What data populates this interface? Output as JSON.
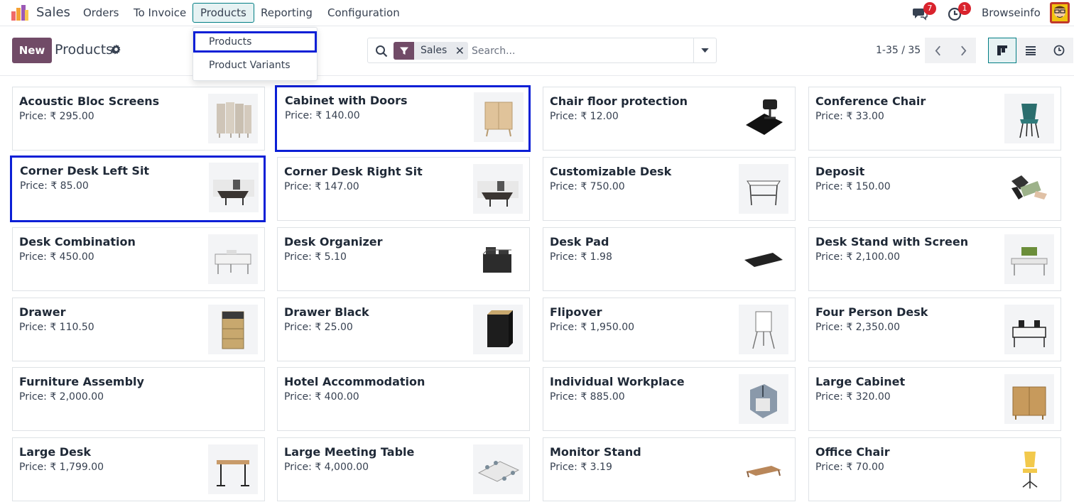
{
  "navbar": {
    "app_name": "Sales",
    "menu": [
      "Orders",
      "To Invoice",
      "Products",
      "Reporting",
      "Configuration"
    ],
    "active_menu": "Products",
    "messages_count": "7",
    "activities_count": "1",
    "company": "Browseinfo"
  },
  "products_dropdown": {
    "items": [
      "Products",
      "Product Variants"
    ]
  },
  "control_panel": {
    "new_label": "New",
    "title": "Products",
    "facet_label": "Sales",
    "search_placeholder": "Search...",
    "pager_value": "1-35 / 35"
  },
  "colors": {
    "brand": "#714b67",
    "active_accent": "#017e84",
    "highlight_box": "#0b1fd6",
    "badge": "#d9232d"
  },
  "products": [
    {
      "name": "Acoustic Bloc Screens",
      "price": "Price: ₹ 295.00",
      "image": "acoustic-screen"
    },
    {
      "name": "Cabinet with Doors",
      "price": "Price: ₹ 140.00",
      "image": "cabinet"
    },
    {
      "name": "Chair floor protection",
      "price": "Price: ₹ 12.00",
      "image": "floor-mat"
    },
    {
      "name": "Conference Chair",
      "price": "Price: ₹ 33.00",
      "image": "chair-teal"
    },
    {
      "name": "Corner Desk Left Sit",
      "price": "Price: ₹ 85.00",
      "image": "corner-desk"
    },
    {
      "name": "Corner Desk Right Sit",
      "price": "Price: ₹ 147.00",
      "image": "corner-desk"
    },
    {
      "name": "Customizable Desk",
      "price": "Price: ₹ 750.00",
      "image": "desk-white"
    },
    {
      "name": "Deposit",
      "price": "Price: ₹ 150.00",
      "image": "money"
    },
    {
      "name": "Desk Combination",
      "price": "Price: ₹ 450.00",
      "image": "desk-combo"
    },
    {
      "name": "Desk Organizer",
      "price": "Price: ₹ 5.10",
      "image": "organizer"
    },
    {
      "name": "Desk Pad",
      "price": "Price: ₹ 1.98",
      "image": "desk-pad"
    },
    {
      "name": "Desk Stand with Screen",
      "price": "Price: ₹ 2,100.00",
      "image": "desk-screen"
    },
    {
      "name": "Drawer",
      "price": "Price: ₹ 110.50",
      "image": "drawer-wood"
    },
    {
      "name": "Drawer Black",
      "price": "Price: ₹ 25.00",
      "image": "drawer-black"
    },
    {
      "name": "Flipover",
      "price": "Price: ₹ 1,950.00",
      "image": "flipover"
    },
    {
      "name": "Four Person Desk",
      "price": "Price: ₹ 2,350.00",
      "image": "four-desk"
    },
    {
      "name": "Furniture Assembly",
      "price": "Price: ₹ 2,000.00",
      "image": ""
    },
    {
      "name": "Hotel Accommodation",
      "price": "Price: ₹ 400.00",
      "image": ""
    },
    {
      "name": "Individual Workplace",
      "price": "Price: ₹ 885.00",
      "image": "workplace"
    },
    {
      "name": "Large Cabinet",
      "price": "Price: ₹ 320.00",
      "image": "large-cabinet"
    },
    {
      "name": "Large Desk",
      "price": "Price: ₹ 1,799.00",
      "image": "large-desk"
    },
    {
      "name": "Large Meeting Table",
      "price": "Price: ₹ 4,000.00",
      "image": "meeting-table"
    },
    {
      "name": "Monitor Stand",
      "price": "Price: ₹ 3.19",
      "image": "monitor-stand"
    },
    {
      "name": "Office Chair",
      "price": "Price: ₹ 70.00",
      "image": "office-chair"
    }
  ],
  "highlighted_products": [
    "Cabinet with Doors",
    "Corner Desk Left Sit"
  ]
}
